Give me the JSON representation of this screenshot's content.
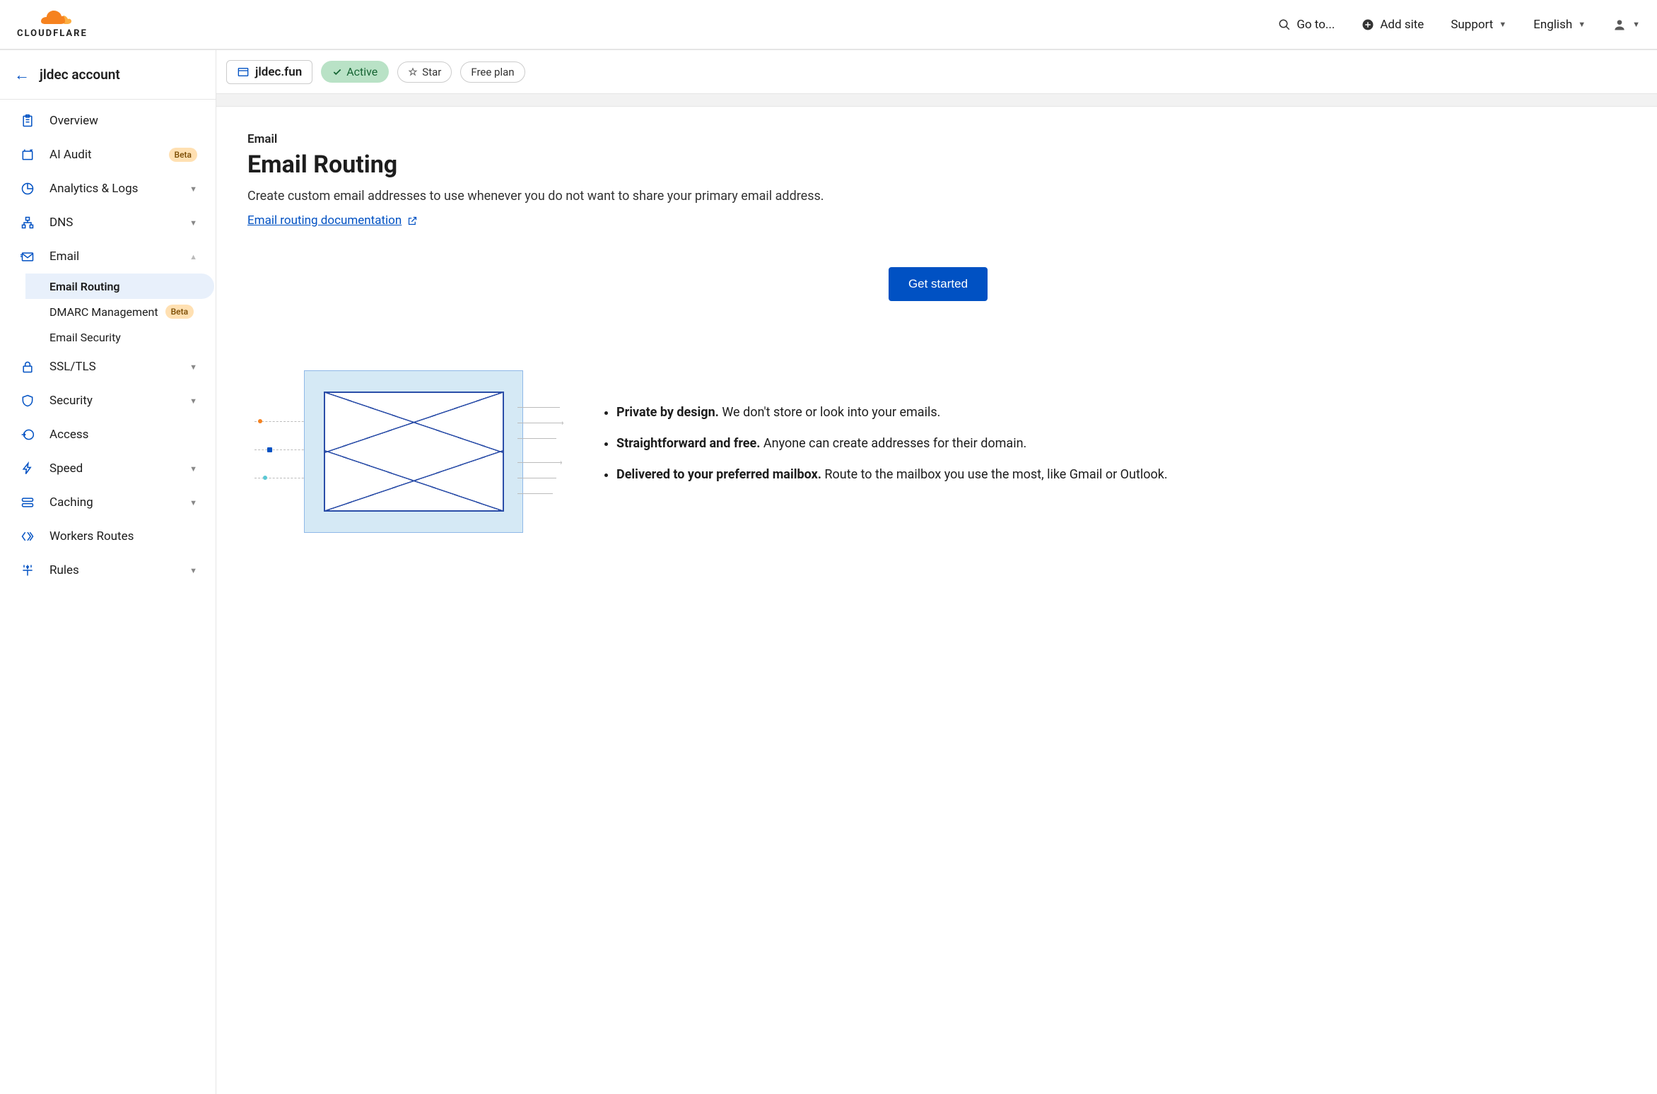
{
  "topbar": {
    "goto": "Go to...",
    "add_site": "Add site",
    "support": "Support",
    "language": "English"
  },
  "account": {
    "name": "jldec account"
  },
  "sidebar": {
    "overview": "Overview",
    "ai_audit": "AI Audit",
    "ai_audit_badge": "Beta",
    "analytics": "Analytics & Logs",
    "dns": "DNS",
    "email": "Email",
    "email_routing": "Email Routing",
    "dmarc": "DMARC Management",
    "dmarc_badge": "Beta",
    "email_security": "Email Security",
    "ssl": "SSL/TLS",
    "security": "Security",
    "access": "Access",
    "speed": "Speed",
    "caching": "Caching",
    "workers": "Workers Routes",
    "rules": "Rules"
  },
  "zone": {
    "name": "jldec.fun",
    "status": "Active",
    "star": "Star",
    "plan": "Free plan"
  },
  "page": {
    "eyebrow": "Email",
    "title": "Email Routing",
    "description": "Create custom email addresses to use whenever you do not want to share your primary email address.",
    "doc_link": "Email routing documentation",
    "cta": "Get started",
    "features": [
      {
        "bold": "Private by design.",
        "text": " We don't store or look into your emails."
      },
      {
        "bold": "Straightforward and free.",
        "text": " Anyone can create addresses for their domain."
      },
      {
        "bold": "Delivered to your preferred mailbox.",
        "text": " Route to the mailbox you use the most, like Gmail or Outlook."
      }
    ]
  }
}
